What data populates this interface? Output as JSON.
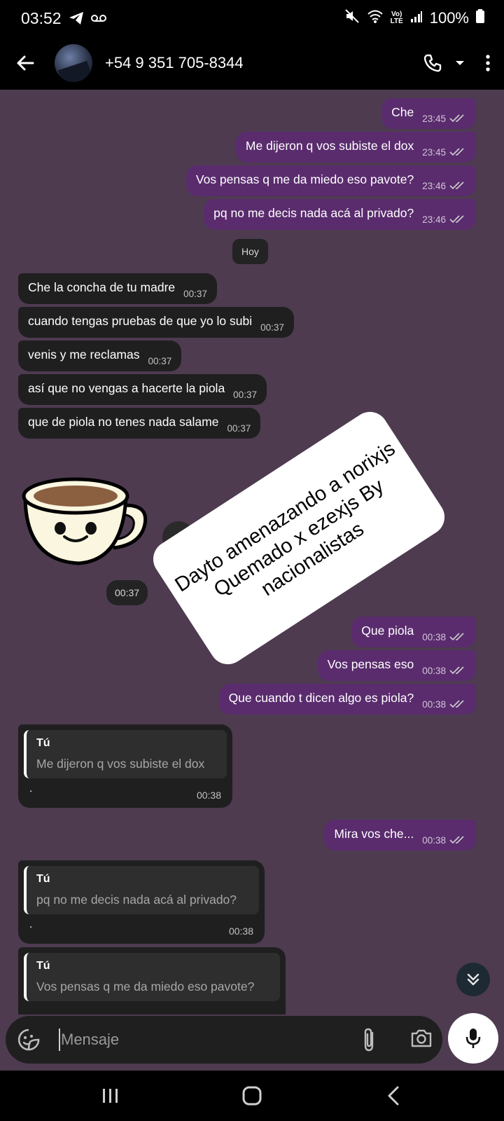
{
  "status_bar": {
    "time": "03:52",
    "network_top": "Vo)",
    "network_bottom": "LTE",
    "battery": "100%"
  },
  "header": {
    "title": "+54 9 351 705-8344"
  },
  "day_chip": "Hoy",
  "messages_top": [
    {
      "text": "Che",
      "time": "23:45"
    },
    {
      "text": "Me dijeron q vos subiste el dox",
      "time": "23:45"
    },
    {
      "text": "Vos pensas q me da miedo eso pavote?",
      "time": "23:46"
    },
    {
      "text": "pq no me decis nada acá al privado?",
      "time": "23:46"
    }
  ],
  "incoming": [
    {
      "text": "Che la concha de tu madre",
      "time": "00:37"
    },
    {
      "text": "cuando tengas pruebas de que yo lo subi",
      "time": "00:37"
    },
    {
      "text": "venis y me reclamas",
      "time": "00:37"
    },
    {
      "text": "así que no vengas a hacerte la piola",
      "time": "00:37"
    },
    {
      "text": "que de piola no tenes nada salame",
      "time": "00:37"
    }
  ],
  "sticker_time": "00:37",
  "overlay": {
    "line1": "Dayto amenazando a norixjs",
    "line2": "Quemado x ezexjs By",
    "line3": "nacionalistas"
  },
  "messages_mid": [
    {
      "text": "Que piola",
      "time": "00:38"
    },
    {
      "text": "Vos pensas eso",
      "time": "00:38"
    },
    {
      "text": "Que cuando t dicen algo es piola?",
      "time": "00:38"
    }
  ],
  "replies": [
    {
      "author": "Tú",
      "quote": "Me dijeron q vos subiste el dox",
      "body": ".",
      "time": "00:38"
    },
    {
      "author": "Tú",
      "quote": "pq no me decis nada acá al privado?",
      "body": ".",
      "time": "00:38"
    },
    {
      "author": "Tú",
      "quote": "Vos pensas q me da miedo eso pavote?"
    }
  ],
  "message_mira": {
    "text": "Mira vos che...",
    "time": "00:38"
  },
  "composer": {
    "placeholder": "Mensaje"
  }
}
